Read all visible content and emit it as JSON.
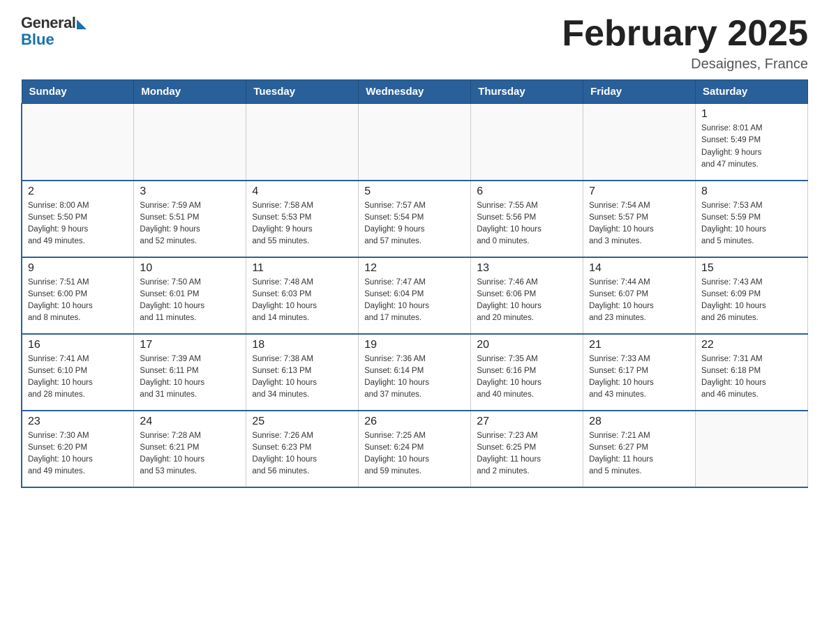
{
  "header": {
    "logo": {
      "general": "General",
      "blue": "Blue"
    },
    "title": "February 2025",
    "location": "Desaignes, France"
  },
  "weekdays": [
    "Sunday",
    "Monday",
    "Tuesday",
    "Wednesday",
    "Thursday",
    "Friday",
    "Saturday"
  ],
  "weeks": [
    [
      {
        "day": "",
        "detail": ""
      },
      {
        "day": "",
        "detail": ""
      },
      {
        "day": "",
        "detail": ""
      },
      {
        "day": "",
        "detail": ""
      },
      {
        "day": "",
        "detail": ""
      },
      {
        "day": "",
        "detail": ""
      },
      {
        "day": "1",
        "detail": "Sunrise: 8:01 AM\nSunset: 5:49 PM\nDaylight: 9 hours\nand 47 minutes."
      }
    ],
    [
      {
        "day": "2",
        "detail": "Sunrise: 8:00 AM\nSunset: 5:50 PM\nDaylight: 9 hours\nand 49 minutes."
      },
      {
        "day": "3",
        "detail": "Sunrise: 7:59 AM\nSunset: 5:51 PM\nDaylight: 9 hours\nand 52 minutes."
      },
      {
        "day": "4",
        "detail": "Sunrise: 7:58 AM\nSunset: 5:53 PM\nDaylight: 9 hours\nand 55 minutes."
      },
      {
        "day": "5",
        "detail": "Sunrise: 7:57 AM\nSunset: 5:54 PM\nDaylight: 9 hours\nand 57 minutes."
      },
      {
        "day": "6",
        "detail": "Sunrise: 7:55 AM\nSunset: 5:56 PM\nDaylight: 10 hours\nand 0 minutes."
      },
      {
        "day": "7",
        "detail": "Sunrise: 7:54 AM\nSunset: 5:57 PM\nDaylight: 10 hours\nand 3 minutes."
      },
      {
        "day": "8",
        "detail": "Sunrise: 7:53 AM\nSunset: 5:59 PM\nDaylight: 10 hours\nand 5 minutes."
      }
    ],
    [
      {
        "day": "9",
        "detail": "Sunrise: 7:51 AM\nSunset: 6:00 PM\nDaylight: 10 hours\nand 8 minutes."
      },
      {
        "day": "10",
        "detail": "Sunrise: 7:50 AM\nSunset: 6:01 PM\nDaylight: 10 hours\nand 11 minutes."
      },
      {
        "day": "11",
        "detail": "Sunrise: 7:48 AM\nSunset: 6:03 PM\nDaylight: 10 hours\nand 14 minutes."
      },
      {
        "day": "12",
        "detail": "Sunrise: 7:47 AM\nSunset: 6:04 PM\nDaylight: 10 hours\nand 17 minutes."
      },
      {
        "day": "13",
        "detail": "Sunrise: 7:46 AM\nSunset: 6:06 PM\nDaylight: 10 hours\nand 20 minutes."
      },
      {
        "day": "14",
        "detail": "Sunrise: 7:44 AM\nSunset: 6:07 PM\nDaylight: 10 hours\nand 23 minutes."
      },
      {
        "day": "15",
        "detail": "Sunrise: 7:43 AM\nSunset: 6:09 PM\nDaylight: 10 hours\nand 26 minutes."
      }
    ],
    [
      {
        "day": "16",
        "detail": "Sunrise: 7:41 AM\nSunset: 6:10 PM\nDaylight: 10 hours\nand 28 minutes."
      },
      {
        "day": "17",
        "detail": "Sunrise: 7:39 AM\nSunset: 6:11 PM\nDaylight: 10 hours\nand 31 minutes."
      },
      {
        "day": "18",
        "detail": "Sunrise: 7:38 AM\nSunset: 6:13 PM\nDaylight: 10 hours\nand 34 minutes."
      },
      {
        "day": "19",
        "detail": "Sunrise: 7:36 AM\nSunset: 6:14 PM\nDaylight: 10 hours\nand 37 minutes."
      },
      {
        "day": "20",
        "detail": "Sunrise: 7:35 AM\nSunset: 6:16 PM\nDaylight: 10 hours\nand 40 minutes."
      },
      {
        "day": "21",
        "detail": "Sunrise: 7:33 AM\nSunset: 6:17 PM\nDaylight: 10 hours\nand 43 minutes."
      },
      {
        "day": "22",
        "detail": "Sunrise: 7:31 AM\nSunset: 6:18 PM\nDaylight: 10 hours\nand 46 minutes."
      }
    ],
    [
      {
        "day": "23",
        "detail": "Sunrise: 7:30 AM\nSunset: 6:20 PM\nDaylight: 10 hours\nand 49 minutes."
      },
      {
        "day": "24",
        "detail": "Sunrise: 7:28 AM\nSunset: 6:21 PM\nDaylight: 10 hours\nand 53 minutes."
      },
      {
        "day": "25",
        "detail": "Sunrise: 7:26 AM\nSunset: 6:23 PM\nDaylight: 10 hours\nand 56 minutes."
      },
      {
        "day": "26",
        "detail": "Sunrise: 7:25 AM\nSunset: 6:24 PM\nDaylight: 10 hours\nand 59 minutes."
      },
      {
        "day": "27",
        "detail": "Sunrise: 7:23 AM\nSunset: 6:25 PM\nDaylight: 11 hours\nand 2 minutes."
      },
      {
        "day": "28",
        "detail": "Sunrise: 7:21 AM\nSunset: 6:27 PM\nDaylight: 11 hours\nand 5 minutes."
      },
      {
        "day": "",
        "detail": ""
      }
    ]
  ]
}
